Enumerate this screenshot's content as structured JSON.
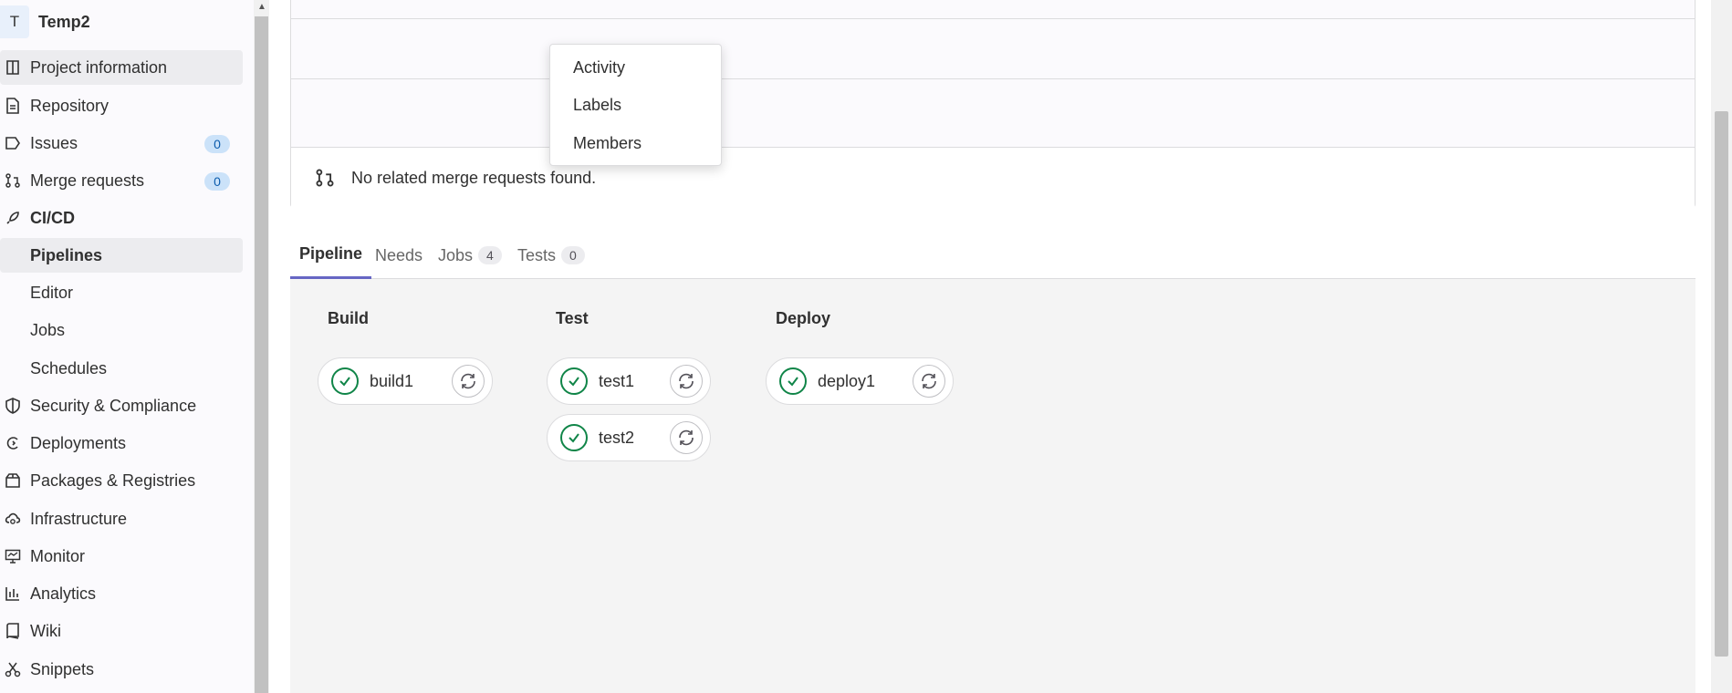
{
  "project": {
    "avatar_letter": "T",
    "name": "Temp2"
  },
  "sidebar": {
    "items": [
      {
        "label": "Project information",
        "icon": "project-icon"
      },
      {
        "label": "Repository",
        "icon": "doc-icon"
      },
      {
        "label": "Issues",
        "icon": "issues-icon",
        "badge": "0"
      },
      {
        "label": "Merge requests",
        "icon": "merge-request-icon",
        "badge": "0"
      },
      {
        "label": "CI/CD",
        "icon": "rocket-icon"
      },
      {
        "label": "Pipelines"
      },
      {
        "label": "Editor"
      },
      {
        "label": "Jobs"
      },
      {
        "label": "Schedules"
      },
      {
        "label": "Security & Compliance",
        "icon": "shield-icon"
      },
      {
        "label": "Deployments",
        "icon": "deployments-icon"
      },
      {
        "label": "Packages & Registries",
        "icon": "package-icon"
      },
      {
        "label": "Infrastructure",
        "icon": "cloud-icon"
      },
      {
        "label": "Monitor",
        "icon": "monitor-icon"
      },
      {
        "label": "Analytics",
        "icon": "chart-icon"
      },
      {
        "label": "Wiki",
        "icon": "book-icon"
      },
      {
        "label": "Snippets",
        "icon": "scissors-icon"
      }
    ]
  },
  "dropdown": {
    "items": [
      "Activity",
      "Labels",
      "Members"
    ]
  },
  "merge_requests": {
    "empty_text": "No related merge requests found."
  },
  "tabs": [
    {
      "label": "Pipeline"
    },
    {
      "label": "Needs"
    },
    {
      "label": "Jobs",
      "count": "4"
    },
    {
      "label": "Tests",
      "count": "0"
    }
  ],
  "stages": [
    {
      "title": "Build",
      "jobs": [
        "build1"
      ]
    },
    {
      "title": "Test",
      "jobs": [
        "test1",
        "test2"
      ]
    },
    {
      "title": "Deploy",
      "jobs": [
        "deploy1"
      ]
    }
  ],
  "colors": {
    "success": "#108548",
    "badge_bg": "#cbe2f9",
    "active_tab": "#6666c4"
  }
}
